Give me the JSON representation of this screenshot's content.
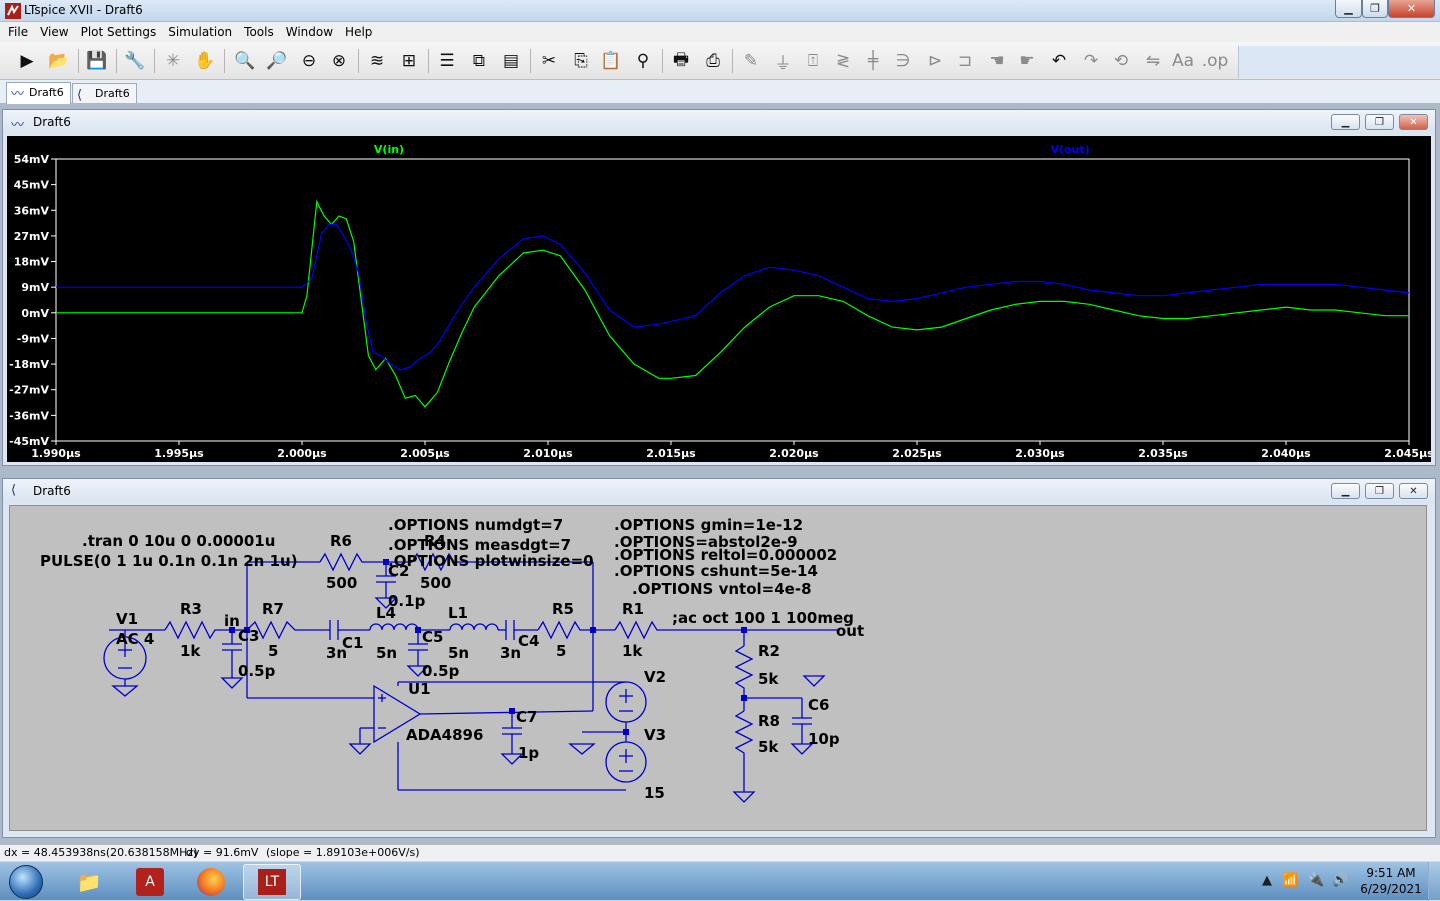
{
  "window": {
    "title": "LTspice XVII - Draft6"
  },
  "menu": [
    "File",
    "View",
    "Plot Settings",
    "Simulation",
    "Tools",
    "Window",
    "Help"
  ],
  "tabs": [
    {
      "label": "Draft6",
      "kind": "waveform"
    },
    {
      "label": "Draft6",
      "kind": "schematic"
    }
  ],
  "plot_window": {
    "title": "Draft6"
  },
  "schematic_window": {
    "title": "Draft6"
  },
  "traces": [
    {
      "label": "V(in)",
      "color": "#00ff00"
    },
    {
      "label": "V(out)",
      "color": "#0000ff"
    }
  ],
  "chart_data": {
    "type": "line",
    "title": "",
    "xlabel": "",
    "ylabel": "",
    "x_unit": "µs",
    "y_unit": "mV",
    "xlim": [
      1.99,
      2.045
    ],
    "ylim": [
      -45,
      54
    ],
    "background": "#000000",
    "x_ticks": [
      "1.990µs",
      "1.995µs",
      "2.000µs",
      "2.005µs",
      "2.010µs",
      "2.015µs",
      "2.020µs",
      "2.025µs",
      "2.030µs",
      "2.035µs",
      "2.040µs",
      "2.045µs"
    ],
    "y_ticks": [
      "54mV",
      "45mV",
      "36mV",
      "27mV",
      "18mV",
      "9mV",
      "0mV",
      "-9mV",
      "-18mV",
      "-27mV",
      "-36mV",
      "-45mV"
    ],
    "series": [
      {
        "name": "V(in)",
        "color": "#00ff00",
        "x": [
          1.99,
          2.0,
          2.0002,
          2.0006,
          2.0009,
          2.0012,
          2.0015,
          2.0018,
          2.0021,
          2.0024,
          2.0027,
          2.003,
          2.0034,
          2.0038,
          2.0042,
          2.0046,
          2.005,
          2.0055,
          2.006,
          2.0065,
          2.007,
          2.008,
          2.009,
          2.0098,
          2.0105,
          2.0115,
          2.0125,
          2.0135,
          2.0145,
          2.015,
          2.016,
          2.017,
          2.018,
          2.019,
          2.02,
          2.021,
          2.022,
          2.023,
          2.024,
          2.025,
          2.026,
          2.027,
          2.028,
          2.029,
          2.03,
          2.031,
          2.032,
          2.033,
          2.034,
          2.035,
          2.036,
          2.037,
          2.038,
          2.039,
          2.04,
          2.041,
          2.042,
          2.043,
          2.044,
          2.045
        ],
        "y": [
          0,
          0,
          6,
          39,
          34,
          31,
          34,
          33,
          25,
          5,
          -15,
          -20,
          -16,
          -22,
          -30,
          -29,
          -33,
          -28,
          -17,
          -7,
          2,
          13,
          21,
          22,
          20,
          8,
          -8,
          -18,
          -23,
          -23,
          -22,
          -14,
          -5,
          2,
          6,
          6,
          4,
          -1,
          -5,
          -6,
          -5,
          -2,
          1,
          3,
          4,
          4,
          3,
          1,
          -1,
          -2,
          -2,
          -1,
          0,
          1,
          2,
          1,
          1,
          0,
          -1,
          -1
        ]
      },
      {
        "name": "V(out)",
        "color": "#0000ff",
        "x": [
          1.99,
          2.0,
          2.0004,
          2.0008,
          2.0011,
          2.0014,
          2.0017,
          2.002,
          2.0023,
          2.0026,
          2.0029,
          2.0032,
          2.0036,
          2.004,
          2.0044,
          2.0048,
          2.0052,
          2.0056,
          2.006,
          2.0065,
          2.007,
          2.008,
          2.009,
          2.0098,
          2.0105,
          2.0115,
          2.0125,
          2.0135,
          2.0145,
          2.015,
          2.016,
          2.017,
          2.018,
          2.019,
          2.02,
          2.021,
          2.022,
          2.023,
          2.024,
          2.025,
          2.026,
          2.027,
          2.028,
          2.029,
          2.03,
          2.031,
          2.032,
          2.033,
          2.034,
          2.035,
          2.036,
          2.037,
          2.038,
          2.039,
          2.04,
          2.041,
          2.042,
          2.043,
          2.044,
          2.045
        ],
        "y": [
          9,
          9,
          12,
          28,
          31,
          31,
          27,
          22,
          14,
          -3,
          -14,
          -15,
          -18,
          -20,
          -19,
          -16,
          -14,
          -10,
          -4,
          3,
          9,
          19,
          26,
          27,
          24,
          14,
          1,
          -5,
          -4,
          -3,
          -1,
          7,
          13,
          16,
          15,
          13,
          9,
          5,
          4,
          5,
          7,
          9,
          10,
          11,
          11,
          10,
          8,
          7,
          6,
          6,
          7,
          8,
          9,
          10,
          10,
          10,
          10,
          9,
          8,
          7
        ]
      }
    ]
  },
  "schematic": {
    "directives": [
      ".tran 0 10u 0 0.00001u",
      "PULSE(0 1 1u 0.1n 0.1n 2n 1u)",
      ".OPTIONS numdgt=7",
      ".OPTIONS measdgt=7",
      ".OPTIONS plotwinsize=0",
      ".OPTIONS gmin=1e-12",
      ".OPTIONS=abstol2e-9",
      ".OPTIONS reltol=0.000002",
      ".OPTIONS cshunt=5e-14",
      ".OPTIONS vntol=4e-8",
      ";ac oct 100 1 100meg"
    ],
    "labels": {
      "V1": "V1",
      "V1_value": "AC 4",
      "R3": "R3",
      "R3_value": "1k",
      "in": "in",
      "C3": "C3",
      "C3_value": "0.5p",
      "R7": "R7",
      "R7_value": "5",
      "R6": "R6",
      "R6_value": "500",
      "C2": "C2",
      "C2_value": "0.1p",
      "R4": "R4",
      "R4_value": "500",
      "C1": "C1",
      "C1_value": "3n",
      "L4": "L4",
      "L4_value": "5n",
      "C5": "C5",
      "C5_value": "0.5p",
      "L1": "L1",
      "L1_value": "5n",
      "C4": "C4",
      "C4_value": "3n",
      "R5": "R5",
      "R5_value": "5",
      "R1": "R1",
      "R1_value": "1k",
      "out": "out",
      "R2": "R2",
      "R2_value": "5k",
      "R8": "R8",
      "R8_value": "5k",
      "C6": "C6",
      "C6_value": "10p",
      "U1": "U1",
      "U1_value": "ADA4896",
      "C7": "C7",
      "C7_value": "1p",
      "V2": "V2",
      "V3": "V3",
      "V3_value": "15"
    }
  },
  "status": {
    "dx": "dx = 48.453938ns(20.638158MHz)",
    "dy": "dy = 91.6mV",
    "slope": "(slope = 1.89103e+006V/s)"
  },
  "clock": {
    "time": "9:51 AM",
    "date": "6/29/2021"
  }
}
